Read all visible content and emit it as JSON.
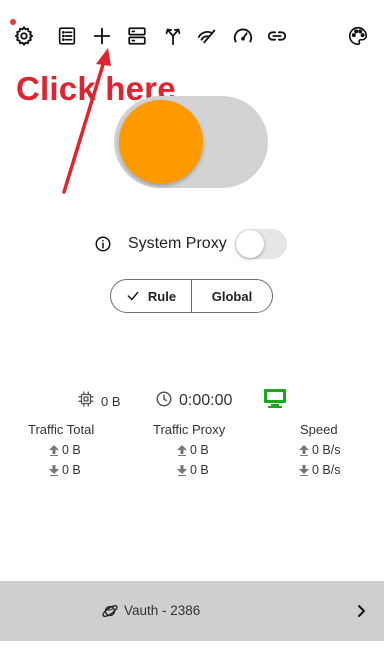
{
  "toolbar": {
    "icons": [
      "settings-icon",
      "list-icon",
      "add-icon",
      "server-icon",
      "route-icon",
      "fast-icon",
      "speedometer-icon",
      "link-icon",
      "palette-icon"
    ],
    "notification_color": "#e53935"
  },
  "annotation": {
    "text": "Click here",
    "color": "#e0242f"
  },
  "main_toggle": {
    "state": "on",
    "knob_color": "#ff9900",
    "track_color": "#d3d3d3"
  },
  "system_proxy": {
    "label": "System Proxy",
    "state": "off"
  },
  "mode": {
    "options": [
      "Rule",
      "Global"
    ],
    "selected": "Rule"
  },
  "stats": {
    "memory": "0 B",
    "uptime": "0:00:00",
    "status_color": "#18a818",
    "traffic_total": {
      "title": "Traffic Total",
      "up": "0 B",
      "down": "0 B"
    },
    "traffic_proxy": {
      "title": "Traffic Proxy",
      "up": "0 B",
      "down": "0 B"
    },
    "speed": {
      "title": "Speed",
      "up": "0 B/s",
      "down": "0 B/s"
    }
  },
  "server": {
    "label": "Vauth - 2386"
  }
}
